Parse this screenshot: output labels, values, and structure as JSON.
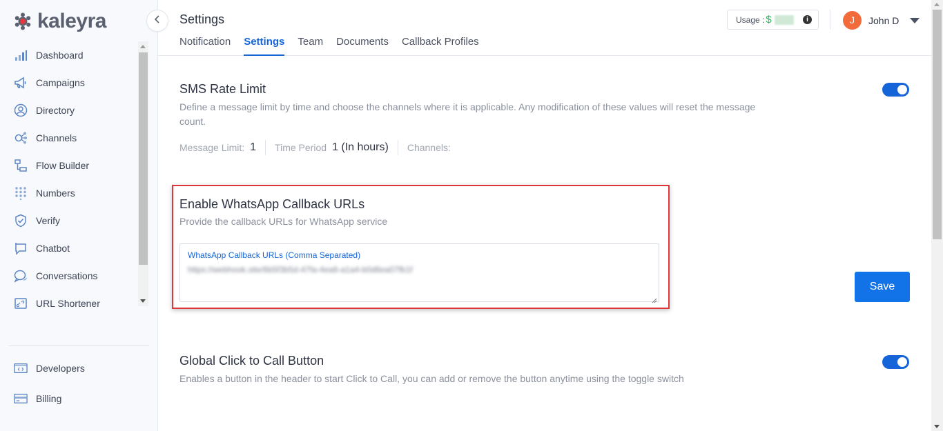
{
  "brand": {
    "name": "kaleyra"
  },
  "sidebar": {
    "items": [
      {
        "label": "Dashboard",
        "icon": "bar-chart-icon"
      },
      {
        "label": "Campaigns",
        "icon": "megaphone-icon"
      },
      {
        "label": "Directory",
        "icon": "person-circle-icon"
      },
      {
        "label": "Channels",
        "icon": "channels-nodes-icon"
      },
      {
        "label": "Flow Builder",
        "icon": "flow-builder-icon"
      },
      {
        "label": "Numbers",
        "icon": "dial-grid-icon"
      },
      {
        "label": "Verify",
        "icon": "shield-check-icon"
      },
      {
        "label": "Chatbot",
        "icon": "chatbot-icon"
      },
      {
        "label": "Conversations",
        "icon": "chat-bubbles-icon"
      },
      {
        "label": "URL Shortener",
        "icon": "link-icon"
      }
    ],
    "bottom_items": [
      {
        "label": "Developers",
        "icon": "code-window-icon"
      },
      {
        "label": "Billing",
        "icon": "credit-card-icon"
      }
    ]
  },
  "header": {
    "title": "Settings",
    "tabs": [
      "Notification",
      "Settings",
      "Team",
      "Documents",
      "Callback Profiles"
    ],
    "active_tab": "Settings",
    "usage_label": "Usage :",
    "usage_currency": "$",
    "user_initial": "J",
    "user_name": "John D"
  },
  "sms_rate_limit": {
    "title": "SMS Rate Limit",
    "description": "Define a message limit by time and choose the channels where it is applicable. Any modification of these values will reset the message count.",
    "enabled": true,
    "message_limit_label": "Message Limit:",
    "message_limit_value": "1",
    "time_period_label": "Time Period",
    "time_period_value": "1 (In hours)",
    "channels_label": "Channels:"
  },
  "whatsapp_callback": {
    "title": "Enable WhatsApp Callback URLs",
    "description": "Provide the callback URLs for WhatsApp service",
    "field_label": "WhatsApp Callback URLs (Comma Separated)",
    "field_value": "https://webhook.site/6b5f3b5d-47fa-4ea6-a1a4-b0d6ea07fb1f",
    "save_label": "Save"
  },
  "click_to_call": {
    "title": "Global Click to Call Button",
    "description": "Enables a button in the header to start Click to Call, you can add or remove the button anytime using the toggle switch",
    "enabled": true
  },
  "colors": {
    "accent": "#1565d8",
    "save_button": "#1273e8",
    "highlight_border": "#e0353a",
    "avatar": "#f26b3a",
    "usage_dollar": "#2db45d"
  }
}
